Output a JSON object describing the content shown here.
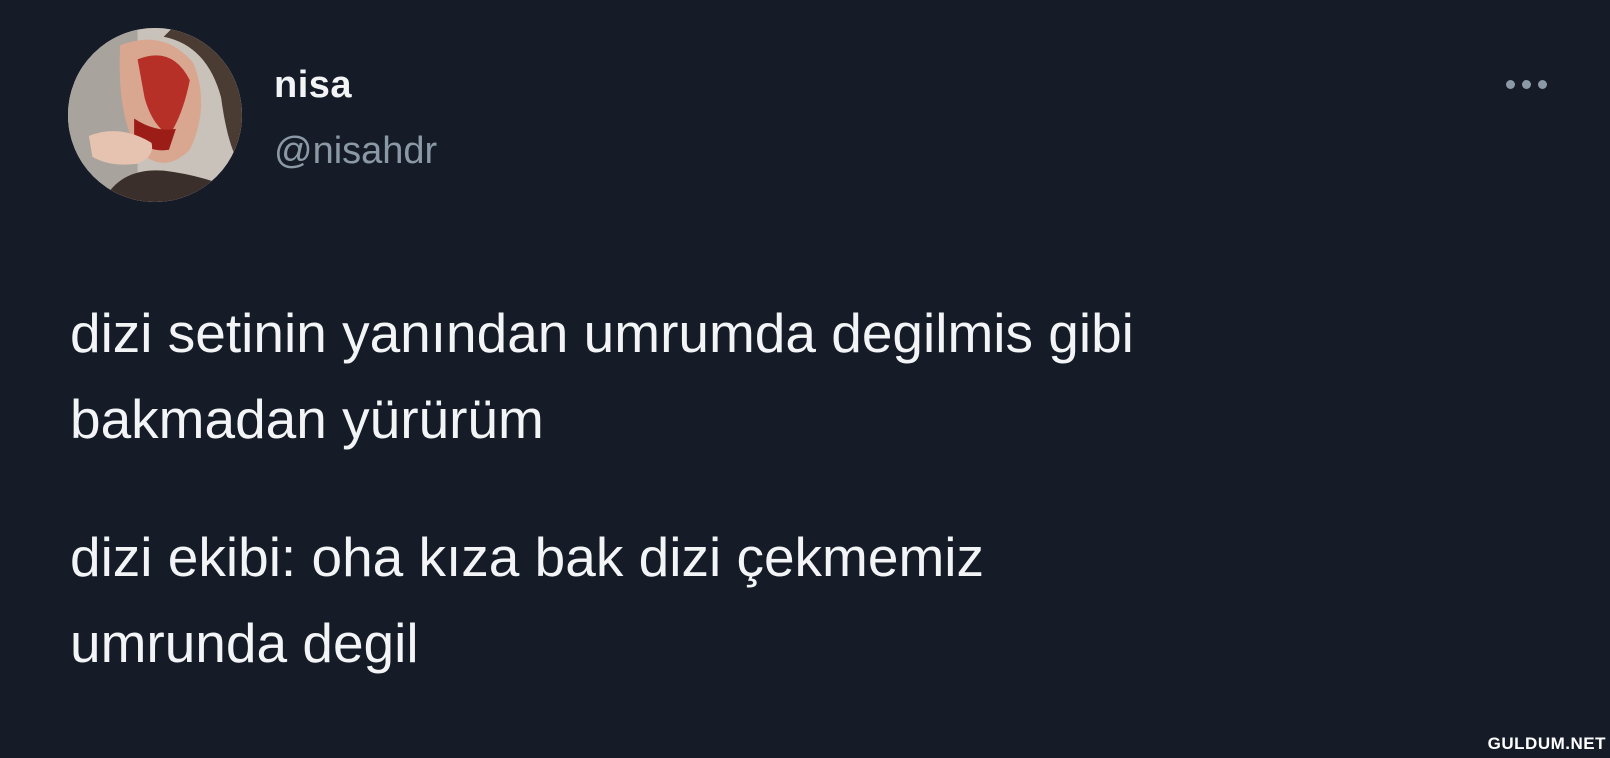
{
  "tweet": {
    "display_name": "nisa",
    "handle": "@nisahdr",
    "more_icon": "more-horizontal-icon",
    "paragraphs": [
      "dizi setinin yanından umrumda degilmis gibi\nbakmadan yürürüm",
      "dizi ekibi: oha kıza bak dizi çekmemiz\numrunda degil"
    ]
  },
  "watermark": "GULDUM.NET",
  "colors": {
    "background": "#151c28",
    "text": "#f2f4f6",
    "secondary_text": "#8b98a5"
  }
}
